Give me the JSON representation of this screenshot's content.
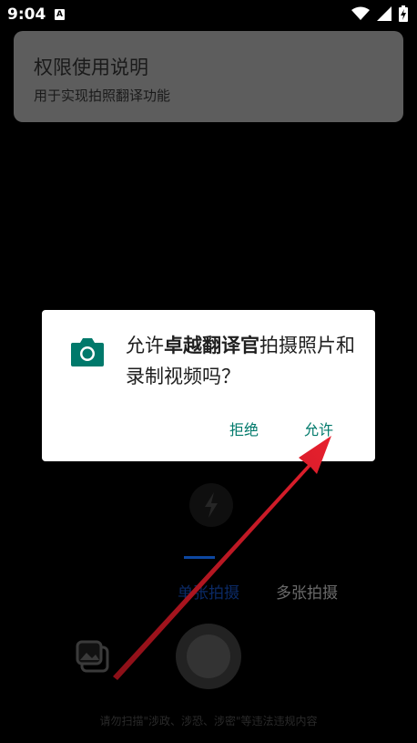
{
  "status_bar": {
    "time": "9:04",
    "notification_icon": "A",
    "icons": [
      "wifi-icon",
      "signal-icon",
      "battery-charging-icon"
    ]
  },
  "permission_banner": {
    "title": "权限使用说明",
    "description": "用于实现拍照翻译功能"
  },
  "dialog": {
    "icon": "camera-icon",
    "message_prefix": "允许",
    "app_name": "卓越翻译官",
    "message_suffix": "拍摄照片和录制视频吗？",
    "deny_label": "拒绝",
    "allow_label": "允许",
    "accent_color": "#00796b"
  },
  "camera": {
    "flash_icon": "flash-off-icon",
    "modes": [
      "单张拍摄",
      "多张拍摄"
    ],
    "gallery_icon": "gallery-icon",
    "legal_note": "请勿扫描\"涉政、涉恐、涉密\"等违法违规内容"
  },
  "annotation": {
    "arrow_color": "#e8202e"
  }
}
